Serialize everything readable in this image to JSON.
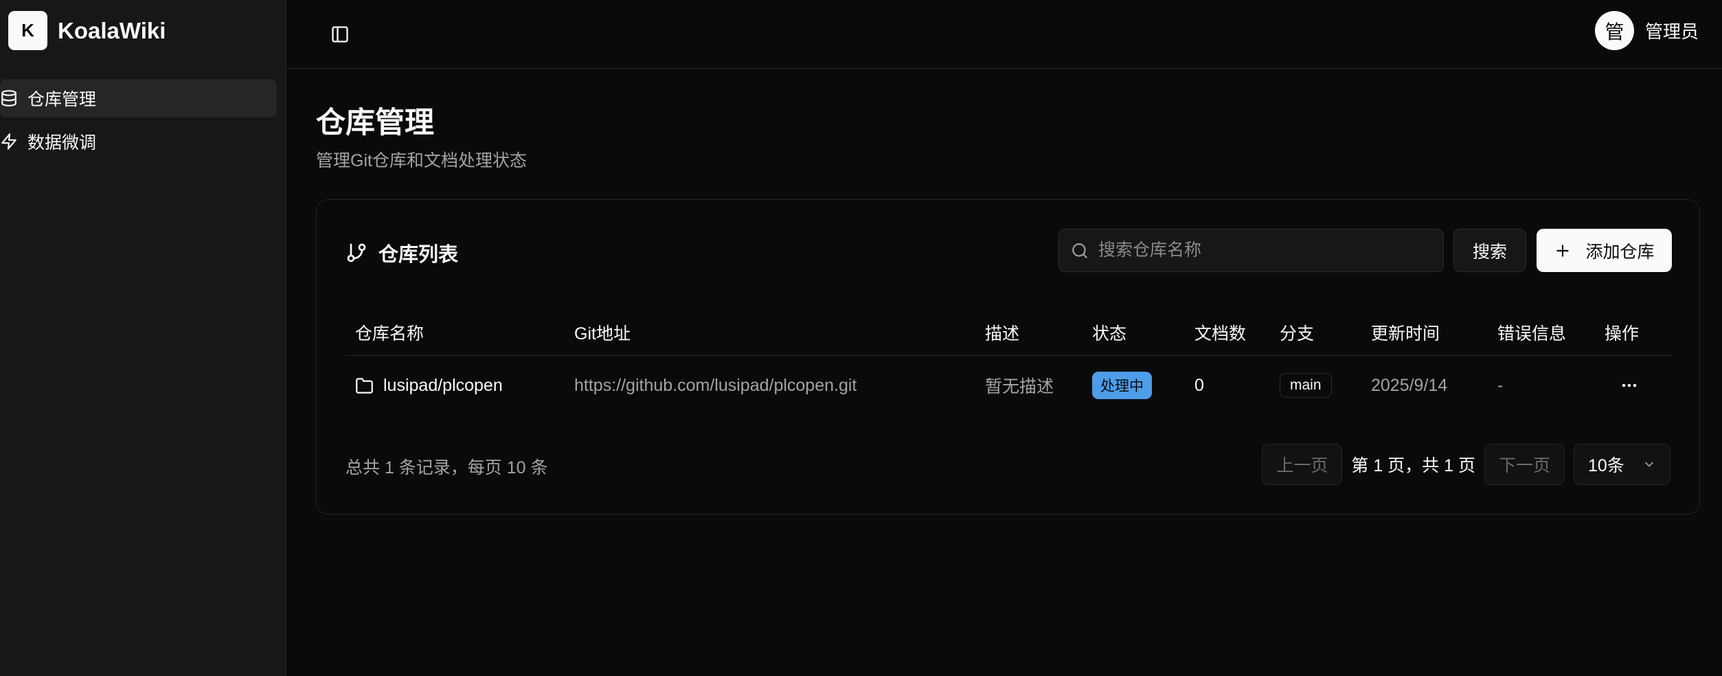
{
  "brand": {
    "logo_letter": "K",
    "name": "KoalaWiki"
  },
  "sidebar": {
    "items": [
      {
        "label": "仓库管理",
        "icon": "database-icon",
        "active": true
      },
      {
        "label": "数据微调",
        "icon": "zap-icon",
        "active": false
      }
    ]
  },
  "topbar": {
    "user": {
      "avatar_char": "管",
      "name": "管理员"
    }
  },
  "page": {
    "title": "仓库管理",
    "subtitle": "管理Git仓库和文档处理状态"
  },
  "card": {
    "title": "仓库列表",
    "search_placeholder": "搜索仓库名称",
    "search_button": "搜索",
    "add_button": "添加仓库"
  },
  "table": {
    "columns": [
      "仓库名称",
      "Git地址",
      "描述",
      "状态",
      "文档数",
      "分支",
      "更新时间",
      "错误信息",
      "操作"
    ],
    "rows": [
      {
        "name": "lusipad/plcopen",
        "git_url": "https://github.com/lusipad/plcopen.git",
        "description": "暂无描述",
        "status": "处理中",
        "doc_count": "0",
        "branch": "main",
        "updated": "2025/9/14",
        "error": "-"
      }
    ]
  },
  "pagination": {
    "total_text": "总共 1 条记录，每页 10 条",
    "prev": "上一页",
    "info": "第 1 页，共 1 页",
    "next": "下一页",
    "page_size": "10条"
  },
  "colors": {
    "background": "#0a0a0a",
    "sidebar": "#171717",
    "status_processing": "#4e9de8"
  }
}
